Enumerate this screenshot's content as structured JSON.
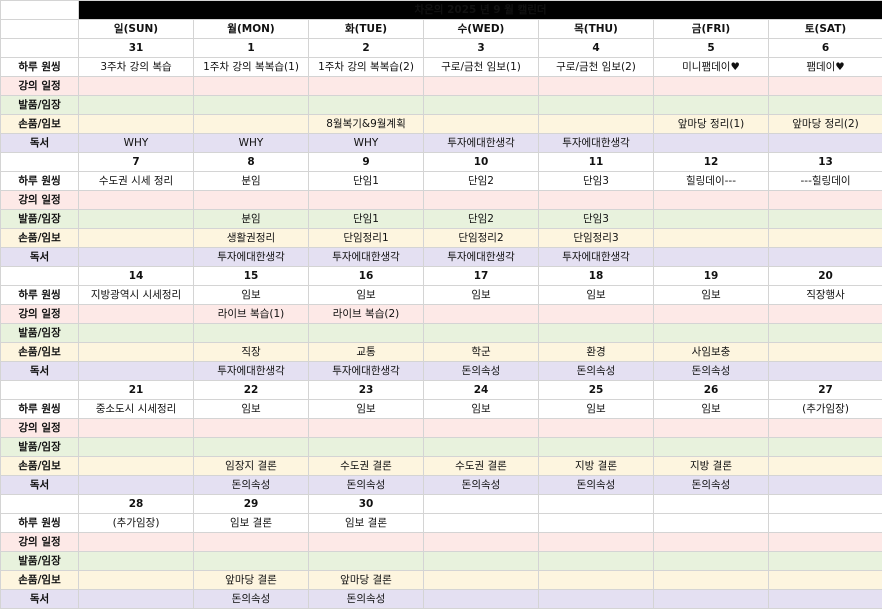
{
  "title": "차온의 2025 년 9 월 캘린더",
  "colors": {
    "sunday": "#e0262a",
    "saturday": "#2446d6"
  },
  "days": [
    "일(SUN)",
    "월(MON)",
    "화(TUE)",
    "수(WED)",
    "목(THU)",
    "금(FRI)",
    "토(SAT)"
  ],
  "row_labels": [
    "하루 원씽",
    "강의 일정",
    "발품/임장",
    "손품/임보",
    "독서"
  ],
  "weeks": [
    {
      "dates": [
        "31",
        "1",
        "2",
        "3",
        "4",
        "5",
        "6"
      ],
      "rows": [
        [
          "3주차 강의 복습",
          "1주차 강의 복복습(1)",
          "1주차 강의 복복습(2)",
          "구로/금천 임보(1)",
          "구로/금천 임보(2)",
          "미니팸데이♥",
          "팸데이♥"
        ],
        [
          "",
          "",
          "",
          "",
          "",
          "",
          ""
        ],
        [
          "",
          "",
          "",
          "",
          "",
          "",
          ""
        ],
        [
          "",
          "",
          "8월복기&9월계획",
          "",
          "",
          "앞마당 정리(1)",
          "앞마당 정리(2)"
        ],
        [
          "WHY",
          "WHY",
          "WHY",
          "투자에대한생각",
          "투자에대한생각",
          "",
          ""
        ]
      ]
    },
    {
      "dates": [
        "7",
        "8",
        "9",
        "10",
        "11",
        "12",
        "13"
      ],
      "rows": [
        [
          "수도권 시세 정리",
          "분임",
          "단임1",
          "단임2",
          "단임3",
          "힐링데이---",
          "---힐링데이"
        ],
        [
          "",
          "",
          "",
          "",
          "",
          "",
          ""
        ],
        [
          "",
          "분임",
          "단임1",
          "단임2",
          "단임3",
          "",
          ""
        ],
        [
          "",
          "생활권정리",
          "단임정리1",
          "단임정리2",
          "단임정리3",
          "",
          ""
        ],
        [
          "",
          "투자에대한생각",
          "투자에대한생각",
          "투자에대한생각",
          "투자에대한생각",
          "",
          ""
        ]
      ]
    },
    {
      "dates": [
        "14",
        "15",
        "16",
        "17",
        "18",
        "19",
        "20"
      ],
      "rows": [
        [
          "지방광역시 시세정리",
          "임보",
          "임보",
          "임보",
          "임보",
          "임보",
          "직장행사"
        ],
        [
          "",
          "라이브 복습(1)",
          "라이브 복습(2)",
          "",
          "",
          "",
          ""
        ],
        [
          "",
          "",
          "",
          "",
          "",
          "",
          ""
        ],
        [
          "",
          "직장",
          "교통",
          "학군",
          "환경",
          "사임보충",
          ""
        ],
        [
          "",
          "투자에대한생각",
          "투자에대한생각",
          "돈의속성",
          "돈의속성",
          "돈의속성",
          ""
        ]
      ]
    },
    {
      "dates": [
        "21",
        "22",
        "23",
        "24",
        "25",
        "26",
        "27"
      ],
      "rows": [
        [
          "중소도시 시세정리",
          "임보",
          "임보",
          "임보",
          "임보",
          "임보",
          "(추가임장)"
        ],
        [
          "",
          "",
          "",
          "",
          "",
          "",
          ""
        ],
        [
          "",
          "",
          "",
          "",
          "",
          "",
          ""
        ],
        [
          "",
          "임장지 결론",
          "수도권 결론",
          "수도권 결론",
          "지방 결론",
          "지방 결론",
          ""
        ],
        [
          "",
          "돈의속성",
          "돈의속성",
          "돈의속성",
          "돈의속성",
          "돈의속성",
          ""
        ]
      ]
    },
    {
      "dates": [
        "28",
        "29",
        "30",
        "",
        "",
        "",
        ""
      ],
      "rows": [
        [
          "(추가임장)",
          "임보 결론",
          "임보 결론",
          "",
          "",
          "",
          ""
        ],
        [
          "",
          "",
          "",
          "",
          "",
          "",
          ""
        ],
        [
          "",
          "",
          "",
          "",
          "",
          "",
          ""
        ],
        [
          "",
          "앞마당 결론",
          "앞마당 결론",
          "",
          "",
          "",
          ""
        ],
        [
          "",
          "돈의속성",
          "돈의속성",
          "",
          "",
          "",
          ""
        ]
      ]
    }
  ]
}
